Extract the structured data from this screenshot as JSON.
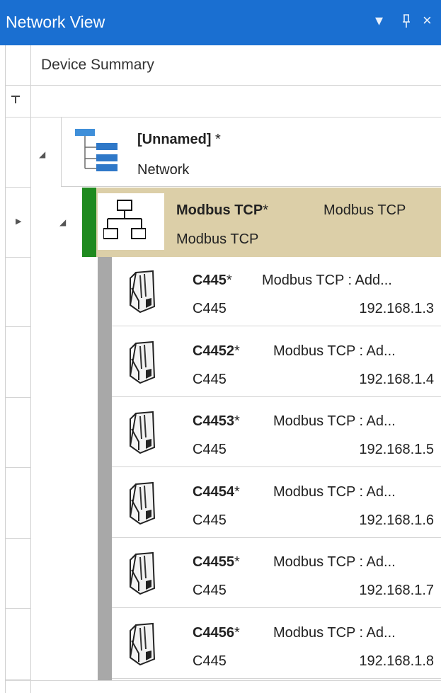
{
  "window": {
    "title": "Network View",
    "dropdown_glyph": "▾",
    "pin_glyph": "ꟸ",
    "close_glyph": "×"
  },
  "header": {
    "column_label": "Device Summary"
  },
  "filter": {
    "icon": "filter-icon",
    "glyph": "▼"
  },
  "network": {
    "name": "[Unnamed]",
    "modified_mark": " *",
    "type": "Network",
    "icon": "tree-network-icon"
  },
  "modbus": {
    "name": "Modbus TCP",
    "modified_mark": "*",
    "description": "Modbus TCP",
    "type": "Modbus TCP",
    "icon": "network-topology-icon",
    "accent_color": "#1f8a1f",
    "row_color": "#dccfa8"
  },
  "devices": [
    {
      "name": "C445",
      "modified_mark": "*",
      "address": "Modbus TCP : Add...",
      "model": "C445",
      "ip": "192.168.1.3"
    },
    {
      "name": "C4452",
      "modified_mark": "*",
      "address": "Modbus TCP : Ad...",
      "model": "C445",
      "ip": "192.168.1.4"
    },
    {
      "name": "C4453",
      "modified_mark": "*",
      "address": "Modbus TCP : Ad...",
      "model": "C445",
      "ip": "192.168.1.5"
    },
    {
      "name": "C4454",
      "modified_mark": "*",
      "address": "Modbus TCP : Ad...",
      "model": "C445",
      "ip": "192.168.1.6"
    },
    {
      "name": "C4455",
      "modified_mark": "*",
      "address": "Modbus TCP : Ad...",
      "model": "C445",
      "ip": "192.168.1.7"
    },
    {
      "name": "C4456",
      "modified_mark": "*",
      "address": "Modbus TCP : Ad...",
      "model": "C445",
      "ip": "192.168.1.8"
    }
  ],
  "colors": {
    "titlebar": "#1a6fd1",
    "device_bar": "#a8a8a8"
  }
}
